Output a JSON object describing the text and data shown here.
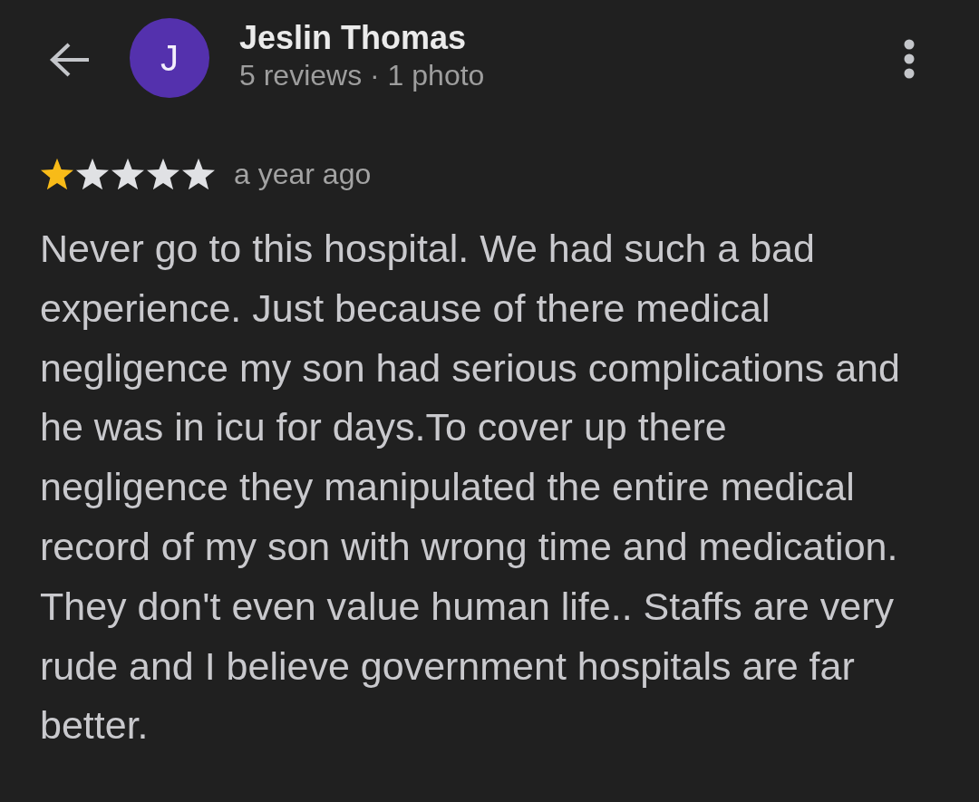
{
  "header": {
    "avatar_letter": "J",
    "name": "Jeslin Thomas",
    "subtitle": "5 reviews · 1 photo"
  },
  "review": {
    "stars": 1,
    "time": "a year ago",
    "text": "Never go to this hospital. We had such a bad experience. Just because of there medical negligence my son had serious complications and he was in icu for days.To cover up there negligence they manipulated the entire medical record of my son with wrong time and medication. They don't even value human life.. Staffs are very rude and I believe government hospitals are far better."
  }
}
